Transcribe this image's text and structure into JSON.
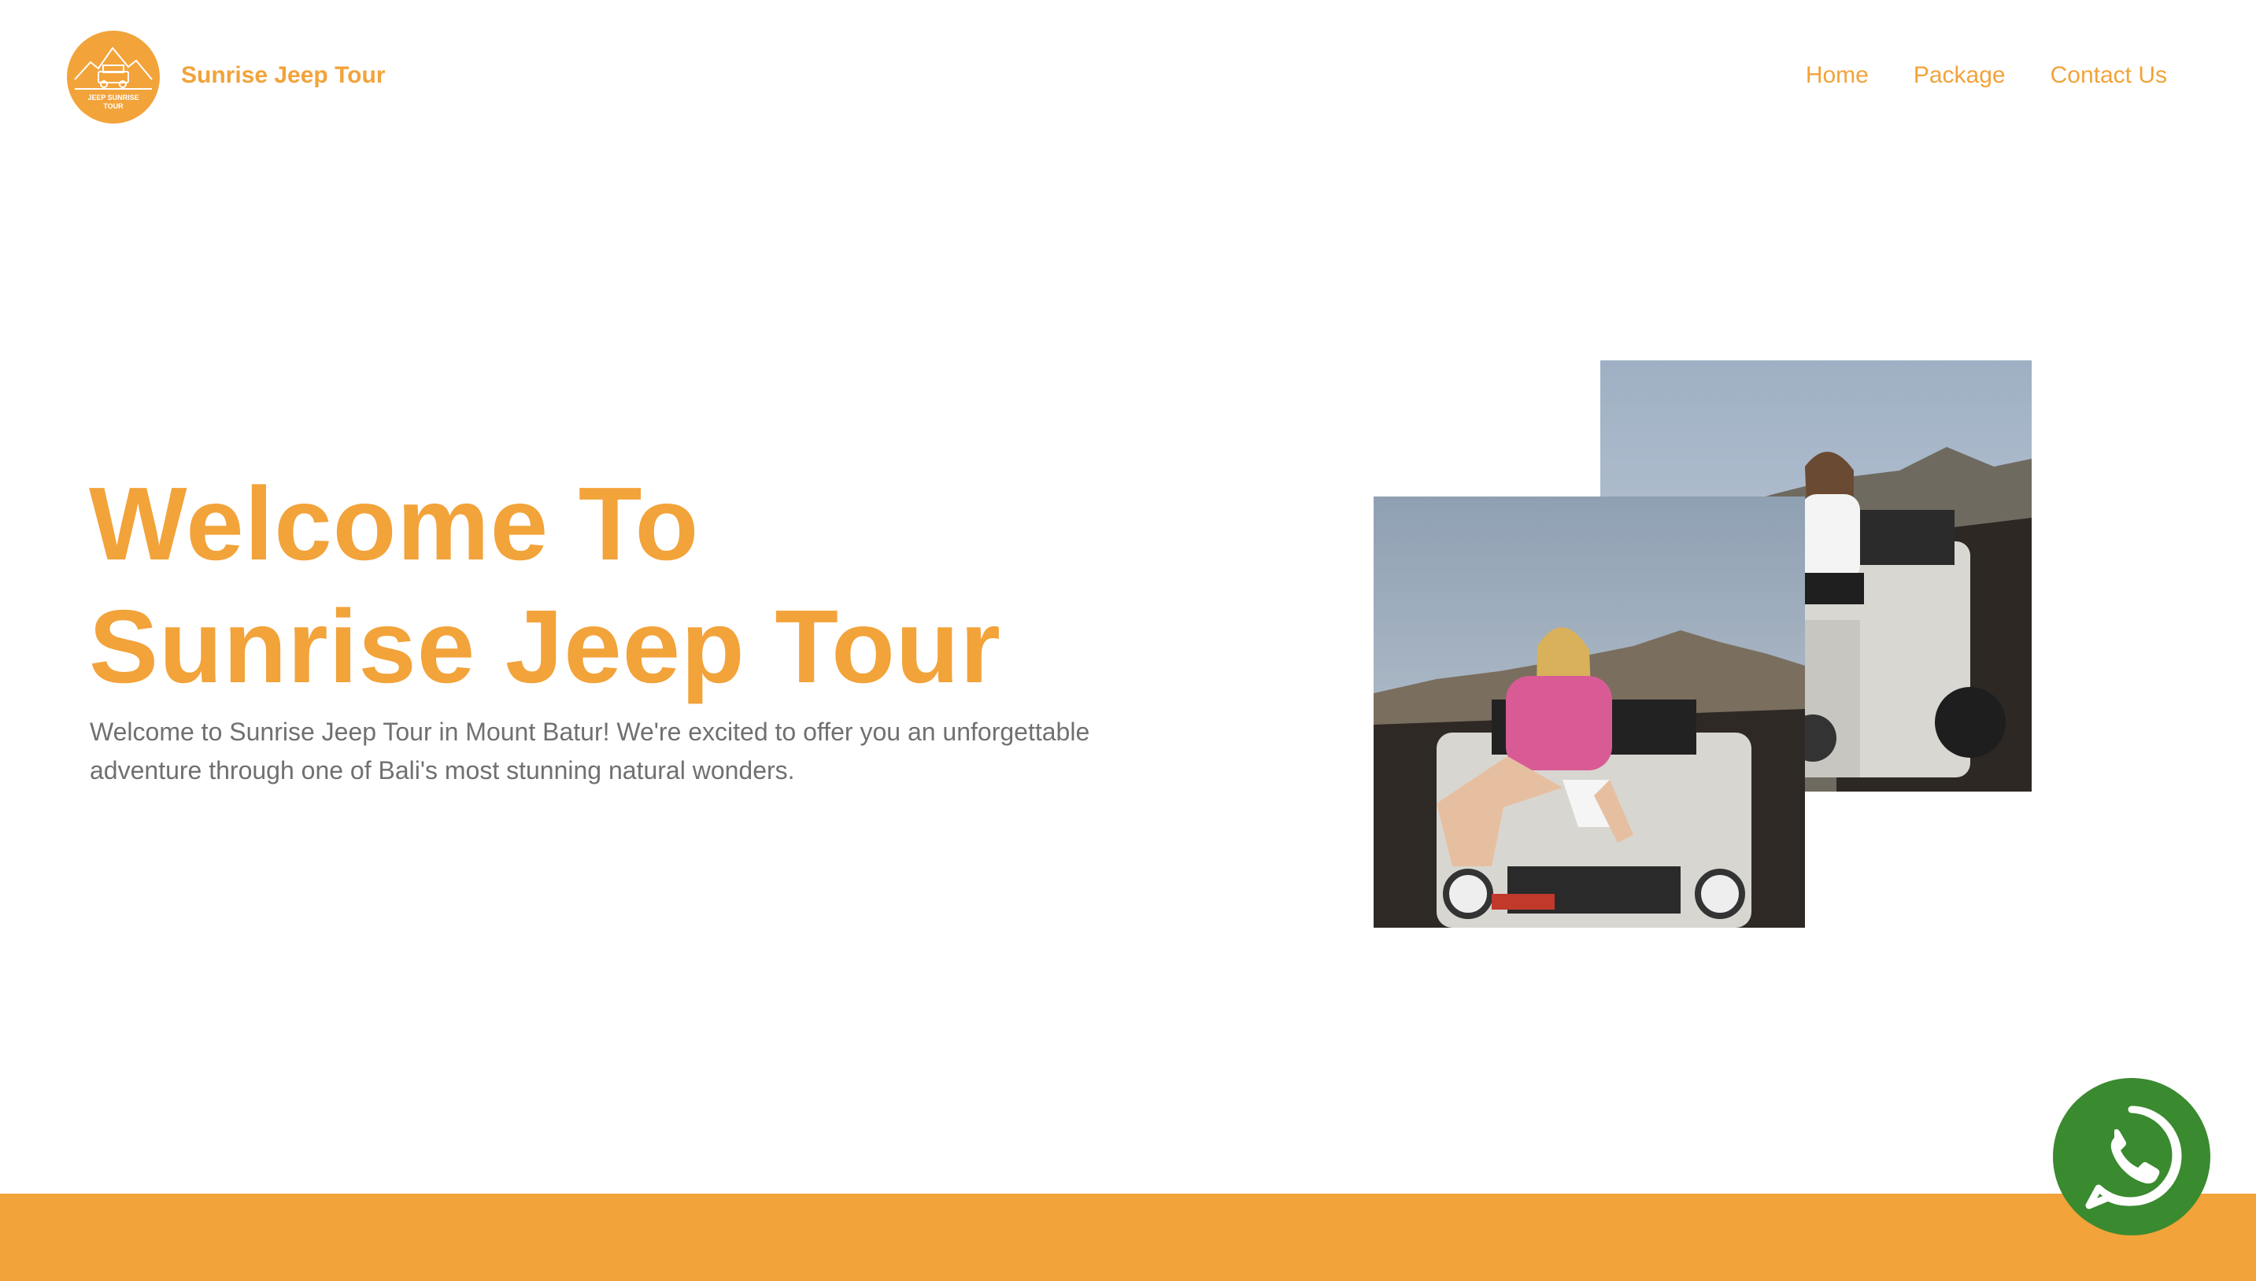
{
  "header": {
    "logo_alt": "Jeep Sunrise Tour logo",
    "logo_text_line1": "JEEP SUNRISE",
    "logo_text_line2": "TOUR",
    "brand_name": "Sunrise Jeep Tour",
    "nav": [
      {
        "label": "Home"
      },
      {
        "label": "Package"
      },
      {
        "label": "Contact Us"
      }
    ]
  },
  "hero": {
    "title_line1": "Welcome To",
    "title_line2": "Sunrise Jeep Tour",
    "description": "Welcome to Sunrise Jeep Tour in Mount Batur! We're excited to offer you an unforgettable adventure through one of Bali's most stunning natural wonders."
  },
  "images": [
    {
      "name": "photo-woman-white-jeep-side",
      "icon": "photo"
    },
    {
      "name": "photo-woman-pink-sweater-jeep-hood",
      "icon": "photo"
    }
  ],
  "colors": {
    "brand": "#F2A33A",
    "text_muted": "#707070",
    "whatsapp": "#3A8A2F",
    "background": "#ffffff"
  },
  "floating": {
    "whatsapp_icon": "whatsapp-icon"
  }
}
